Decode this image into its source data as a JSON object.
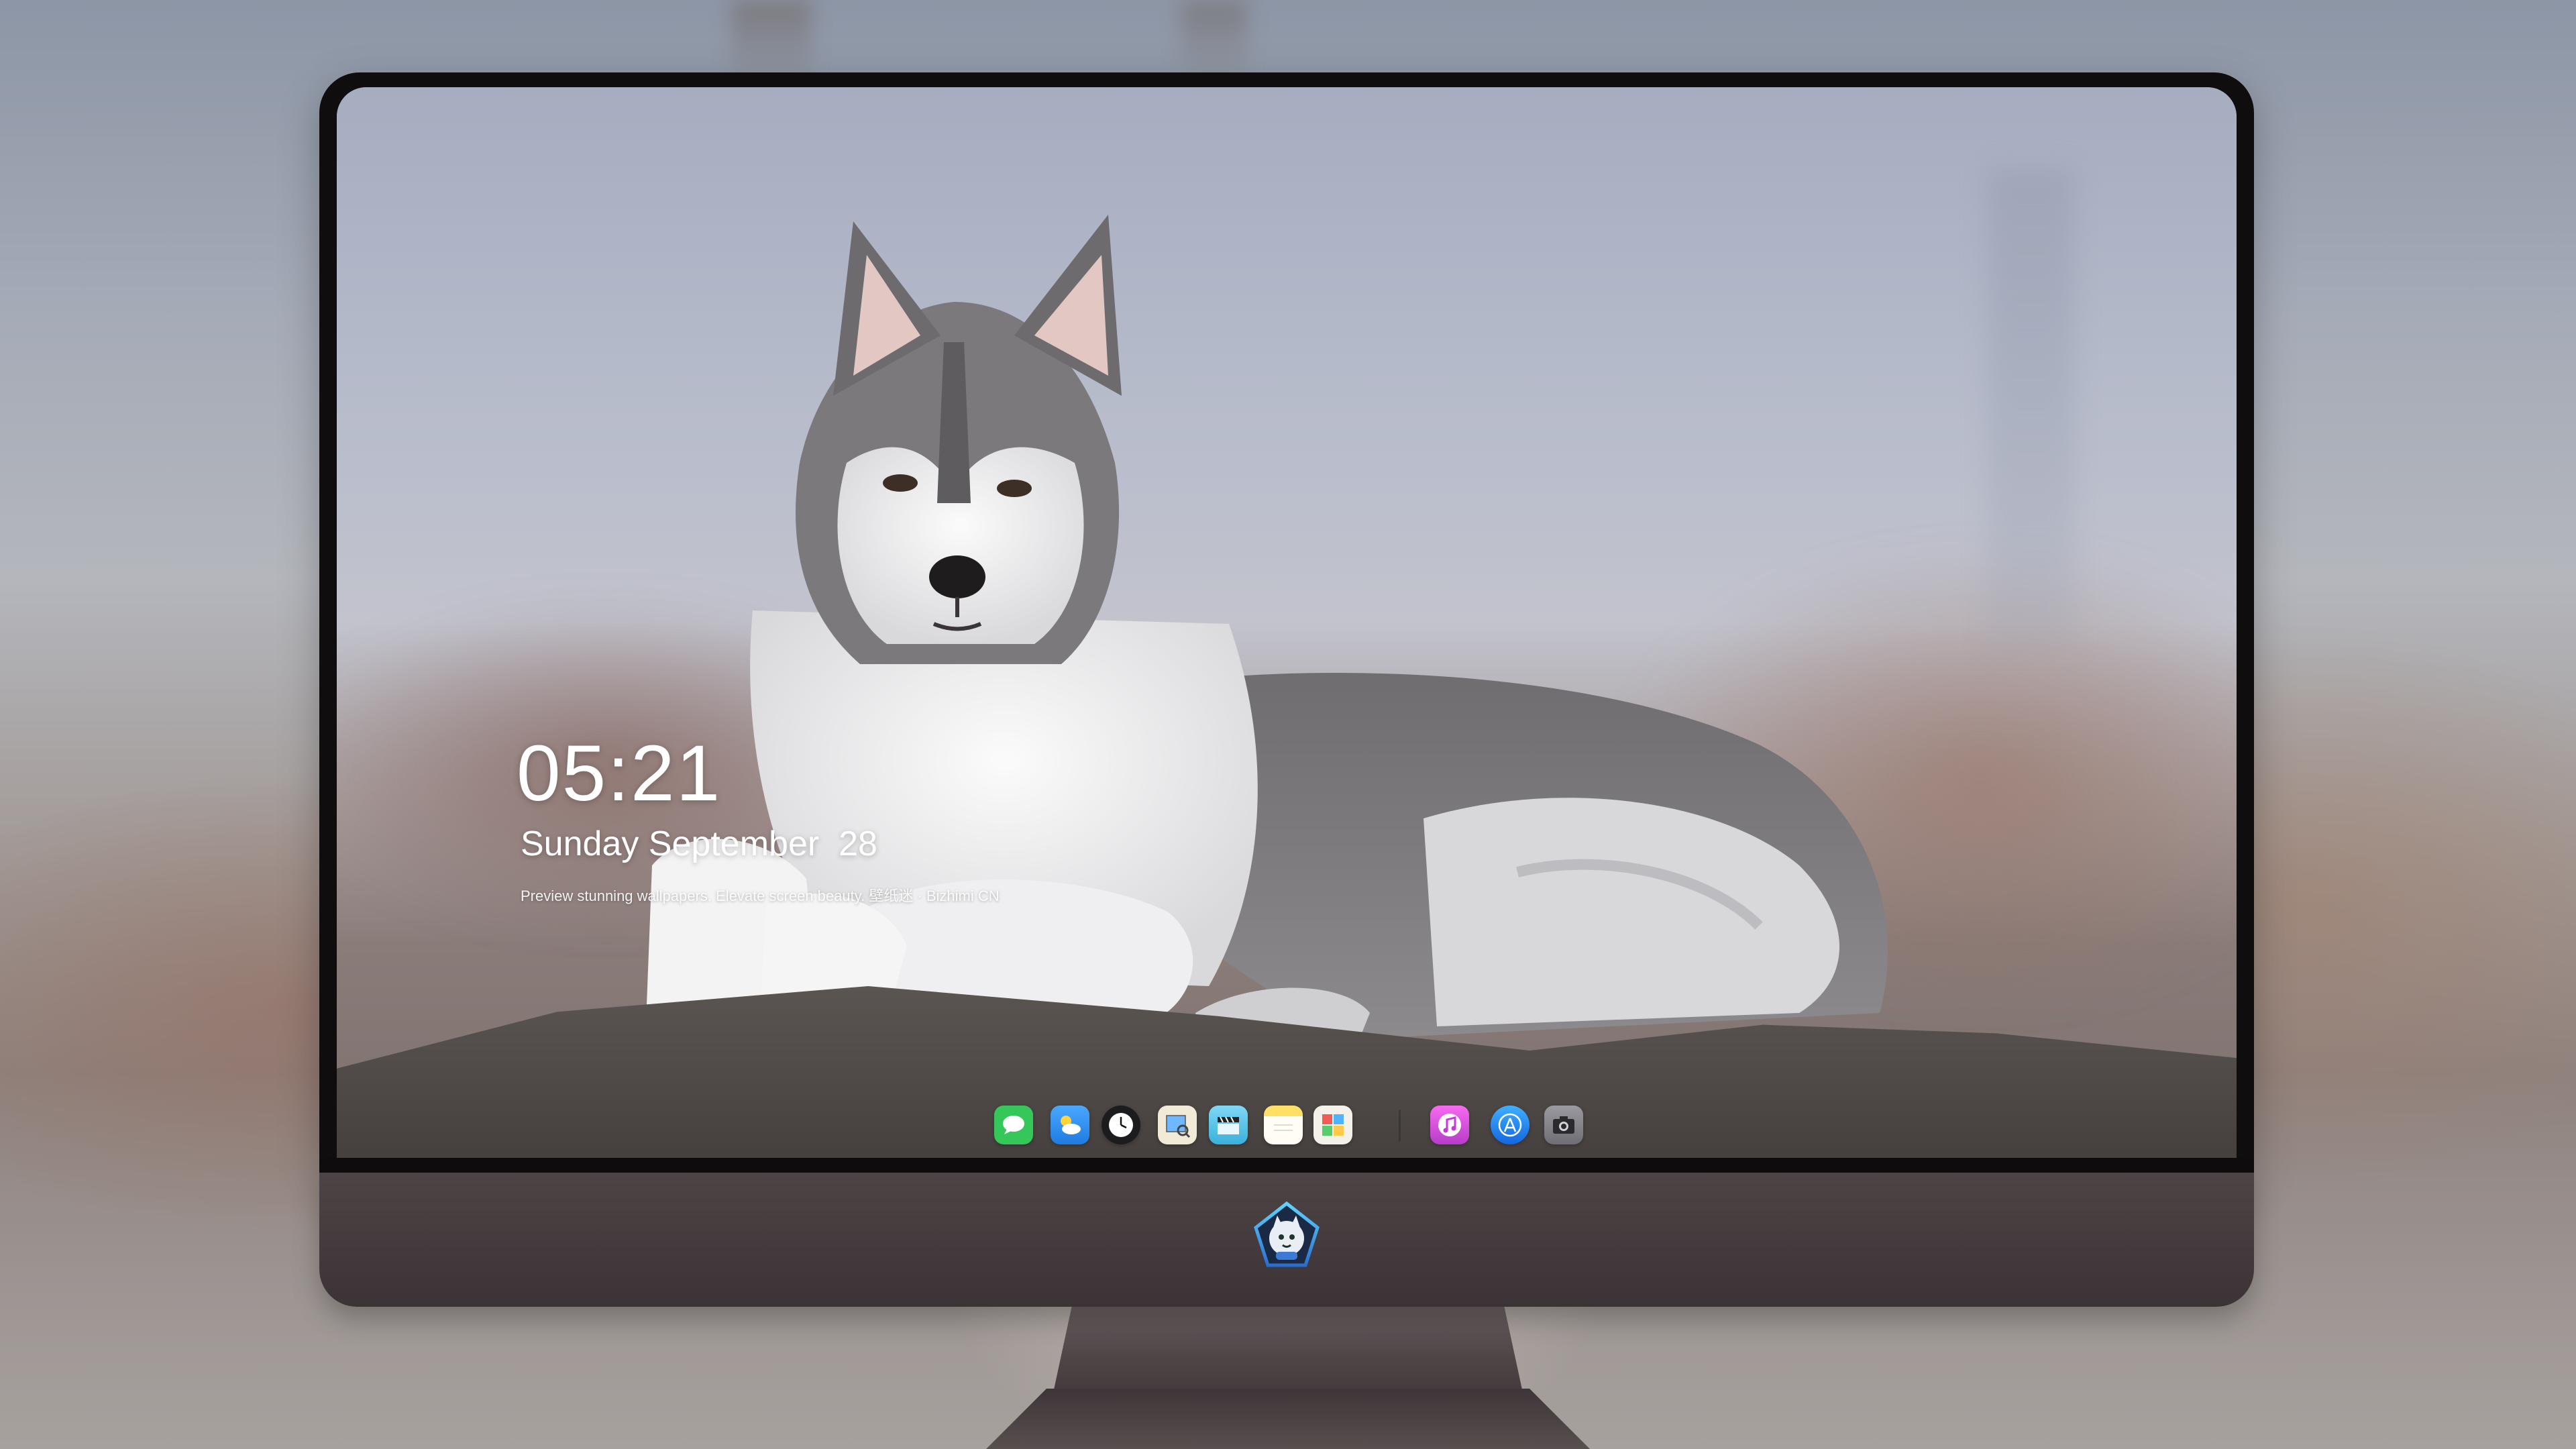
{
  "lock_screen": {
    "time": "05:21",
    "date": "Sunday September  28",
    "caption": "Preview stunning wallpapers. Elevate screen beauty. 壁纸迷 · Bizhimi CN"
  },
  "dock": {
    "apps": [
      {
        "icon": "messages-icon",
        "color": "#35c759"
      },
      {
        "icon": "weather-icon",
        "color": "#3b9cf6"
      },
      {
        "icon": "clock-icon",
        "color": "#1c1c1e"
      },
      {
        "icon": "preview-icon",
        "color": "#e9e3d4"
      },
      {
        "icon": "clips-icon",
        "color": "#59c3e7"
      },
      {
        "icon": "notes-icon",
        "color": "#ffd84a"
      },
      {
        "icon": "photo-booth-icon",
        "color": "#f4f1ea"
      },
      {
        "icon": "music-icon",
        "color": "#e44bd8"
      },
      {
        "icon": "app-store-icon",
        "color": "#1d8ff5"
      },
      {
        "icon": "camera-icon",
        "color": "#8e8e93"
      }
    ]
  },
  "monitor": {
    "logo_icon": "mascot-logo-icon"
  }
}
